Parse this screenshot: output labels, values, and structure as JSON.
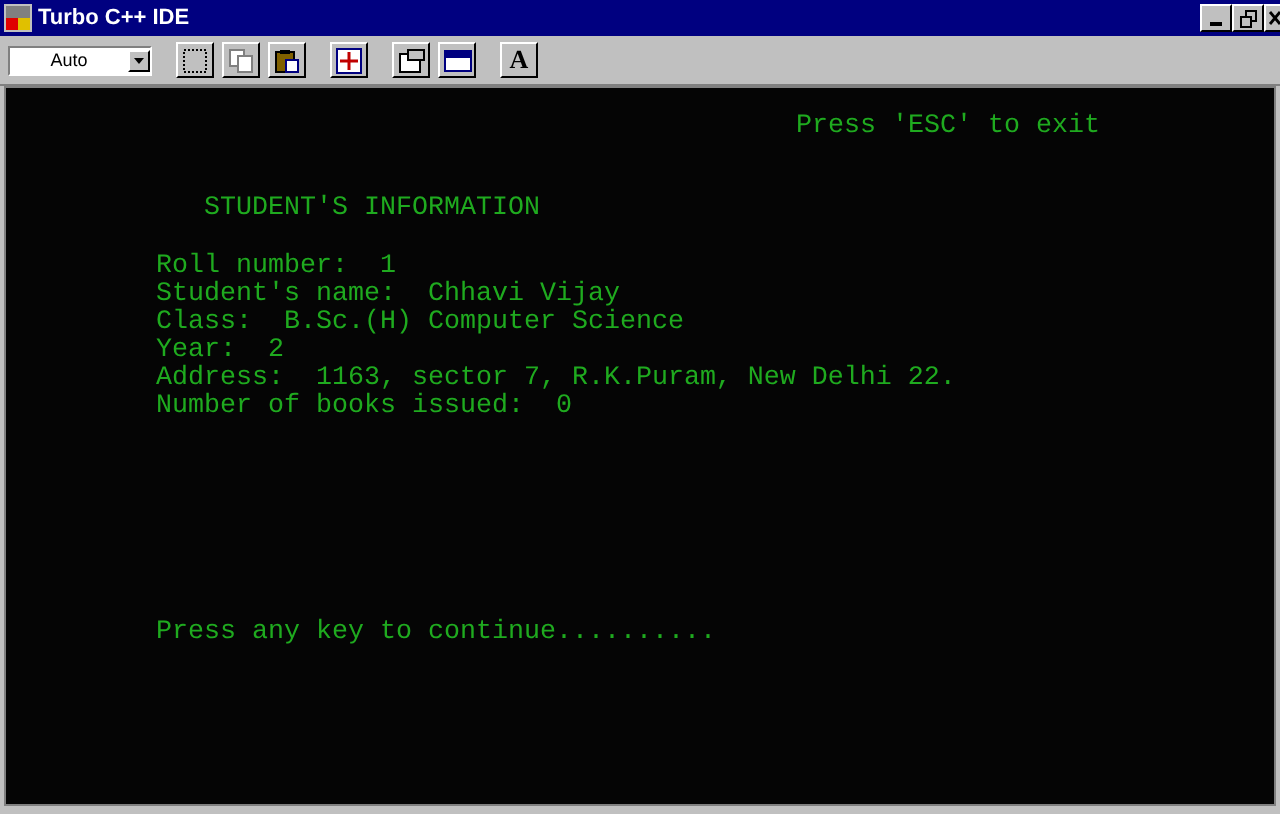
{
  "window": {
    "title": "Turbo C++ IDE"
  },
  "toolbar": {
    "font_size": "Auto",
    "font_button": "A"
  },
  "console": {
    "exit_hint": "Press 'ESC' to exit",
    "heading": "STUDENT'S INFORMATION",
    "lines": [
      "Roll number:  1",
      "Student's name:  Chhavi Vijay",
      "Class:  B.Sc.(H) Computer Science",
      "Year:  2",
      "Address:  1163, sector 7, R.K.Puram, New Delhi 22.",
      "Number of books issued:  0"
    ],
    "prompt": "Press any key to continue.........."
  }
}
